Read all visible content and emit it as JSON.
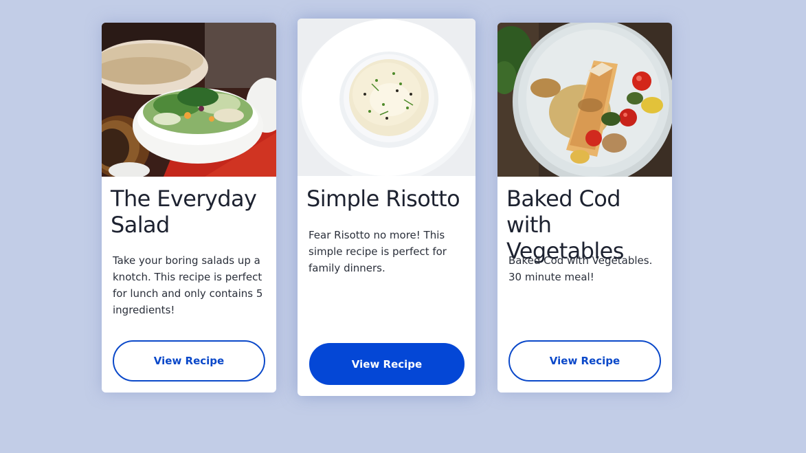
{
  "colors": {
    "page_background": "#c2cde7",
    "card_background": "#ffffff",
    "accent": "#0447d6",
    "text": "#1d2230"
  },
  "cards": [
    {
      "image_icon": "salad-photo",
      "title": "The Everyday Salad",
      "description": "Take your boring salads up a knotch. This recipe is perfect for lunch and only contains 5 ingredients!",
      "button_label": "View Recipe",
      "button_style": "outline"
    },
    {
      "image_icon": "risotto-photo",
      "title": "Simple Risotto",
      "description": "Fear Risotto no more! This simple recipe is perfect for family dinners.",
      "button_label": "View Recipe",
      "button_style": "filled"
    },
    {
      "image_icon": "baked-cod-photo",
      "title": "Baked Cod with Vegetables",
      "description": "Baked Cod with Vegetables. 30 minute meal!",
      "button_label": "View Recipe",
      "button_style": "outline"
    }
  ]
}
